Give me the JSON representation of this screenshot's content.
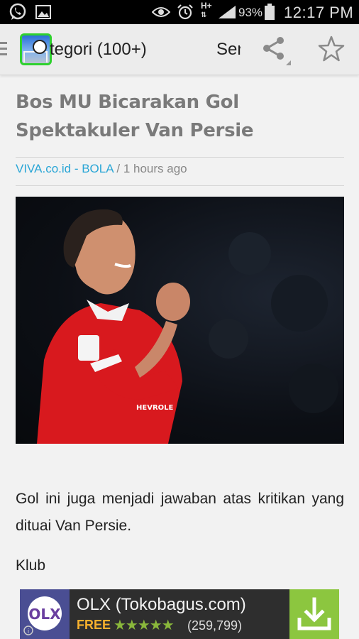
{
  "status_bar": {
    "network": "H+",
    "battery": "93%",
    "time": "12:17 PM",
    "icons": [
      "whatsapp-icon",
      "gallery-icon",
      "eye-icon",
      "alarm-icon",
      "signal-icon",
      "battery-icon"
    ]
  },
  "action_bar": {
    "category_title": "tegori (100+)",
    "next_tab": "Sen",
    "icons": [
      "drawer-icon",
      "app-logo",
      "share-icon",
      "star-icon"
    ]
  },
  "article": {
    "headline": "Bos MU Bicarakan Gol Spektakuler Van Persie",
    "source": "VIVA.co.id - BOLA",
    "separator": " / ",
    "time_ago": "1 hours ago",
    "paragraphs": [
      "Gol ini juga menjadi jawaban atas kritikan yang dituai Van Persie.",
      "Klub"
    ]
  },
  "ad": {
    "logo_text": "OLX",
    "title": "OLX (Tokobagus.com)",
    "price": "FREE",
    "rating": 4.5,
    "rating_stars": "★★★★★",
    "review_count": "(259,799)",
    "colors": {
      "background": "#2e2e2e",
      "download": "#8cc63f",
      "free": "#f7b12d"
    }
  },
  "colors": {
    "source_link": "#2aa6d6",
    "headline": "#7a7a7a",
    "logo_border": "#2fd12f"
  }
}
